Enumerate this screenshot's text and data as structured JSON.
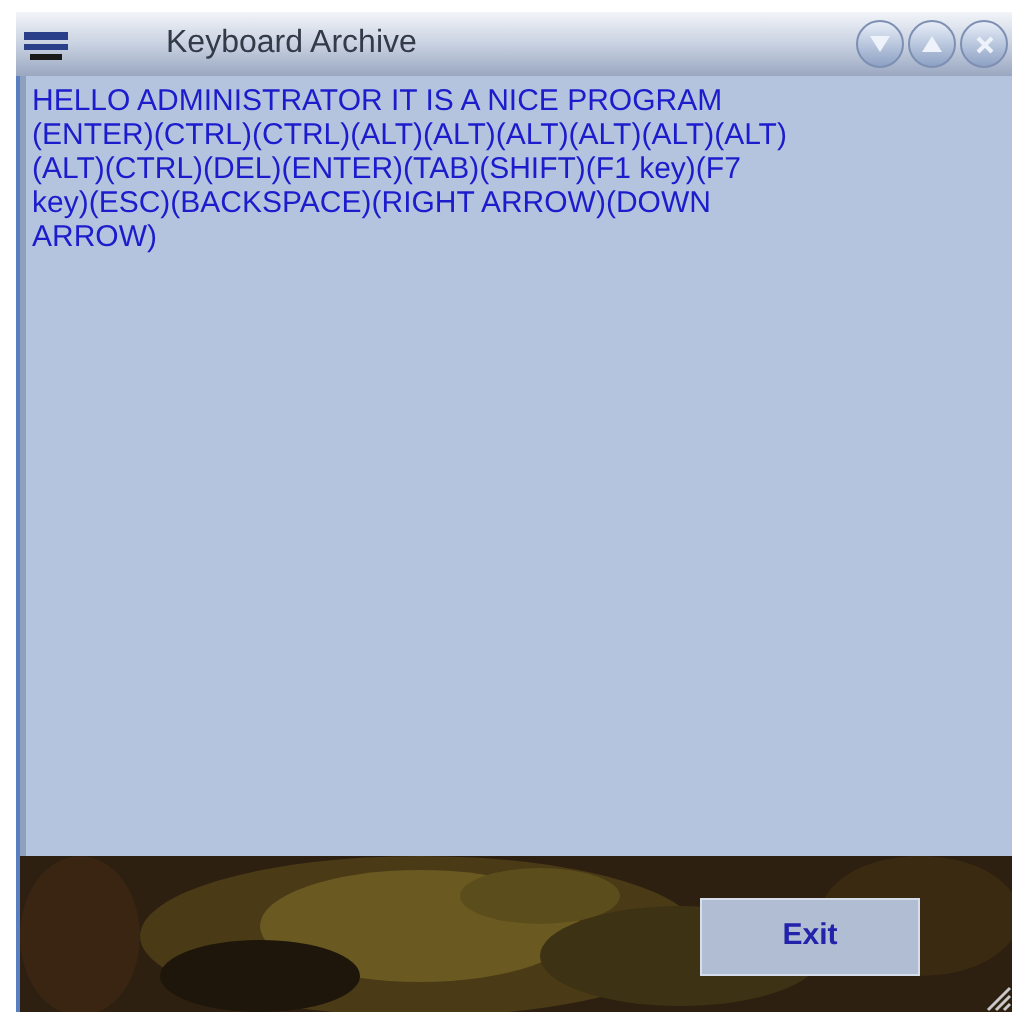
{
  "window": {
    "title": "Keyboard Archive"
  },
  "log": {
    "lines": [
      "HELLO ADMINISTRATOR IT IS A NICE PROGRAM",
      "(ENTER)(CTRL)(CTRL)(ALT)(ALT)(ALT)(ALT)(ALT)(ALT)",
      "(ALT)(CTRL)(DEL)(ENTER)(TAB)(SHIFT)(F1 key)(F7",
      "key)(ESC)(BACKSPACE)(RIGHT ARROW)(DOWN",
      "ARROW)"
    ]
  },
  "buttons": [
    {
      "label": "Exit"
    }
  ]
}
